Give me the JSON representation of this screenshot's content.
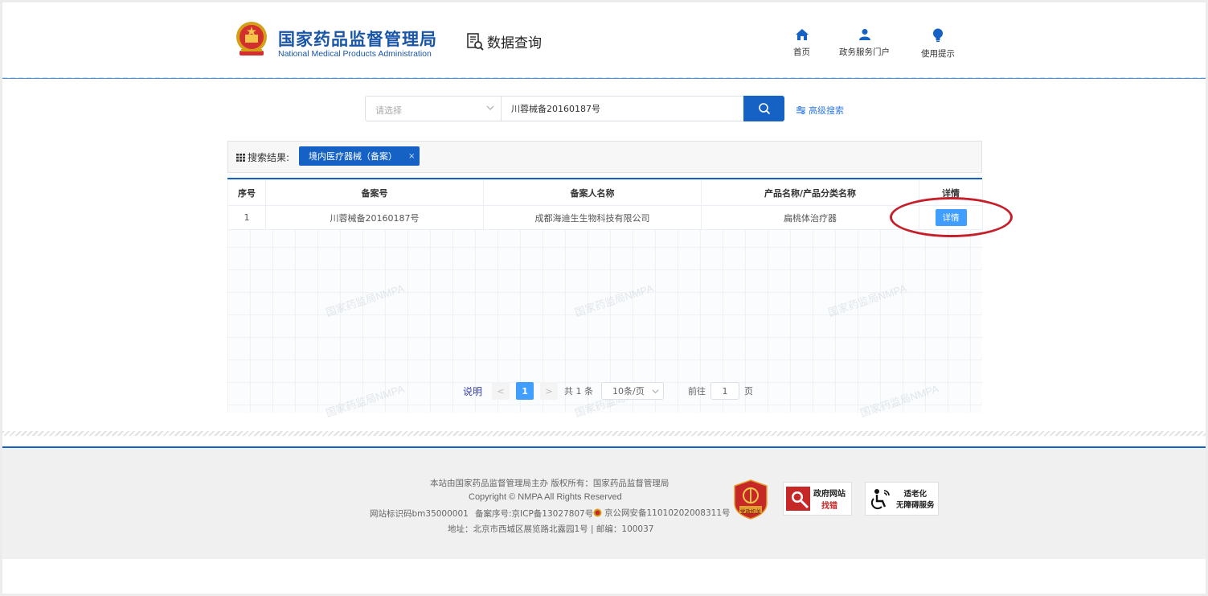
{
  "header": {
    "brand_cn": "国家药品监督管理局",
    "brand_en": "National Medical Products Administration",
    "section_title": "数据查询",
    "nav": [
      {
        "label": "首页",
        "icon": "home-icon"
      },
      {
        "label": "政务服务门户",
        "icon": "user-icon"
      },
      {
        "label": "使用提示",
        "icon": "lightbulb-icon"
      }
    ]
  },
  "search": {
    "select_placeholder": "请选择",
    "query_value": "川蓉械备20160187号",
    "advanced_label": "高级搜索"
  },
  "results": {
    "label": "搜索结果:",
    "tag": "境内医疗器械（备案）",
    "tag_close": "×"
  },
  "table": {
    "headers": [
      "序号",
      "备案号",
      "备案人名称",
      "产品名称/产品分类名称",
      "详情"
    ],
    "rows": [
      {
        "index": "1",
        "record_no": "川蓉械备20160187号",
        "registrant": "成都海迪生生物科技有限公司",
        "product": "扁桃体治疗器",
        "action": "详情"
      }
    ]
  },
  "watermark": "国家药监局NMPA",
  "pagination": {
    "explain": "说明",
    "prev": "<",
    "current_page": "1",
    "next": ">",
    "total": "共 1 条",
    "page_size": "10条/页",
    "goto_label": "前往",
    "goto_value": "1",
    "page_unit": "页"
  },
  "footer": {
    "line1": "本站由国家药品监督管理局主办 版权所有：国家药品监督管理局",
    "line2": "Copyright © NMPA All Rights Reserved",
    "site_id": "网站标识码bm35000001",
    "icp": "备案序号:京ICP备13027807号",
    "police": "京公网安备11010202008311号",
    "address": "地址：北京市西城区展览路北露园1号 | 邮编：100037",
    "badge_party": "党政机关",
    "badge_gov_line1": "政府网站",
    "badge_gov_line2": "找错",
    "badge_access_line1": "适老化",
    "badge_access_line2": "无障碍服务"
  },
  "colors": {
    "brand_blue": "#1a56a8",
    "primary": "#1562c4",
    "button_blue": "#409eff",
    "highlight_red": "#c61f2a"
  }
}
